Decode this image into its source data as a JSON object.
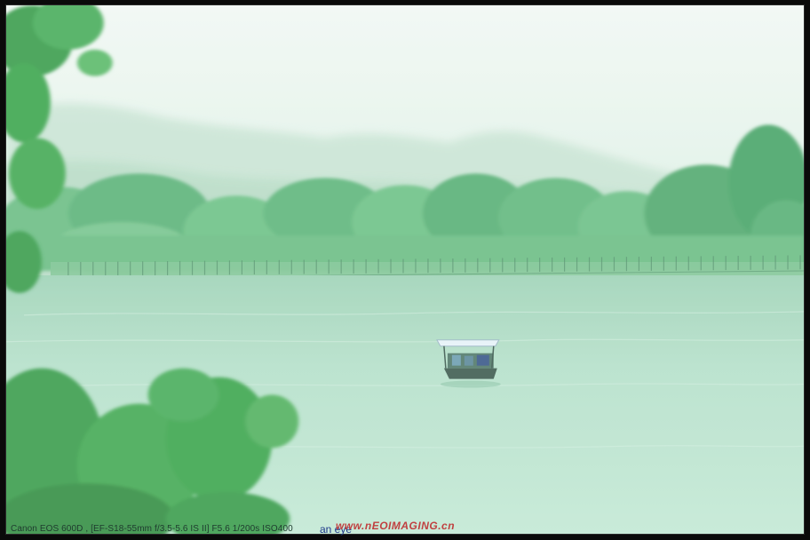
{
  "photo": {
    "subject": "",
    "colors": {
      "sky": "#eef6f1",
      "mist": "#d3eadc",
      "mountain": "#b8dcc7",
      "tree_dark": "#4fae6e",
      "tree_light": "#7cc88f",
      "water_far": "#a9d8bf",
      "water_near": "#bfe6d1",
      "foliage": "#3ea64f",
      "boat": "#3c5a4e",
      "canopy": "#e6f2f8"
    }
  },
  "caption": {
    "exif": "Canon EOS 600D , [EF-S18-55mm f/3.5-5.6 IS II] F5.6 1/200s ISO400",
    "author": "an  eye",
    "watermark": "www.nEOIMAGING.cn"
  }
}
